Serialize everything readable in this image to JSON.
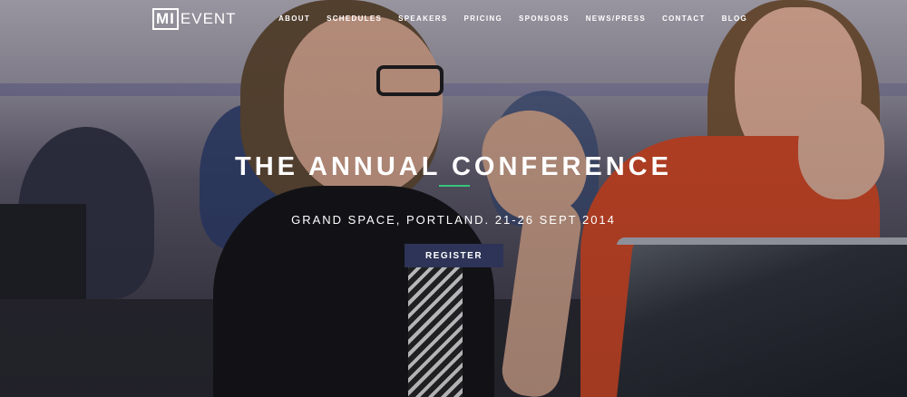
{
  "header": {
    "logo": {
      "boxed": "MI",
      "text": "EVENT"
    },
    "nav": [
      "ABOUT",
      "SCHEDULES",
      "SPEAKERS",
      "PRICING",
      "SPONSORS",
      "NEWS/PRESS",
      "CONTACT",
      "BLOG"
    ]
  },
  "hero": {
    "title": "THE ANNUAL CONFERENCE",
    "subtitle": "GRAND SPACE, PORTLAND. 21-26 SEPT 2014",
    "register_label": "REGISTER"
  },
  "colors": {
    "accent": "#35c67a",
    "button": "#2d3457"
  }
}
